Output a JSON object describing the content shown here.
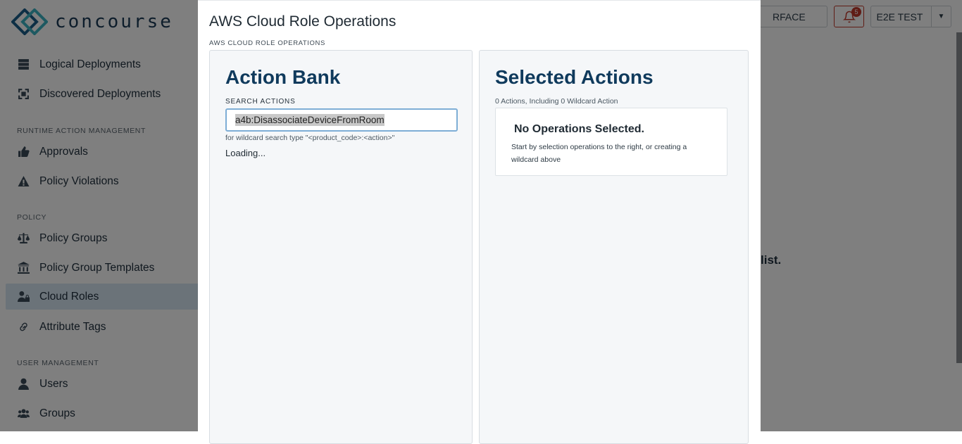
{
  "app": {
    "brand": "concourse",
    "header": {
      "field_text": "RFACE",
      "notification_count": "5",
      "user_label": "E2E TEST"
    },
    "background_text": "list."
  },
  "sidebar": {
    "items_top": [
      {
        "label": "Logical Deployments",
        "icon": "server-stack-icon"
      },
      {
        "label": "Discovered Deployments",
        "icon": "scan-icon"
      }
    ],
    "sections": [
      {
        "title": "RUNTIME ACTION MANAGEMENT",
        "items": [
          {
            "label": "Approvals",
            "icon": "thumbs-up-icon"
          },
          {
            "label": "Policy Violations",
            "icon": "warning-icon"
          }
        ]
      },
      {
        "title": "POLICY",
        "items": [
          {
            "label": "Policy Groups",
            "icon": "scale-icon"
          },
          {
            "label": "Policy Group Templates",
            "icon": "bank-icon"
          },
          {
            "label": "Cloud Roles",
            "icon": "user-lock-icon",
            "active": true
          },
          {
            "label": "Attribute Tags",
            "icon": "link-icon"
          }
        ]
      },
      {
        "title": "USER MANAGEMENT",
        "items": [
          {
            "label": "Users",
            "icon": "user-icon"
          },
          {
            "label": "Groups",
            "icon": "users-icon"
          }
        ]
      }
    ]
  },
  "modal": {
    "title": "AWS Cloud Role Operations",
    "subtitle": "AWS CLOUD ROLE OPERATIONS",
    "action_bank": {
      "title": "Action Bank",
      "search_label": "SEARCH ACTIONS",
      "search_value": "a4b:DisassociateDeviceFromRoom",
      "hint": "for wildcard search type \"<product_code>:<action>\"",
      "status": "Loading..."
    },
    "selected_actions": {
      "title": "Selected Actions",
      "count_text": "0 Actions, Including 0 Wildcard Action",
      "empty_title": "No Operations Selected.",
      "empty_text": "Start by selection operations to the right, or creating a wildcard above"
    }
  },
  "colors": {
    "overlay": "#000000",
    "panel_title": "#0f3a5c",
    "active_nav": "#d7e6f3",
    "notification": "#c0392b"
  }
}
